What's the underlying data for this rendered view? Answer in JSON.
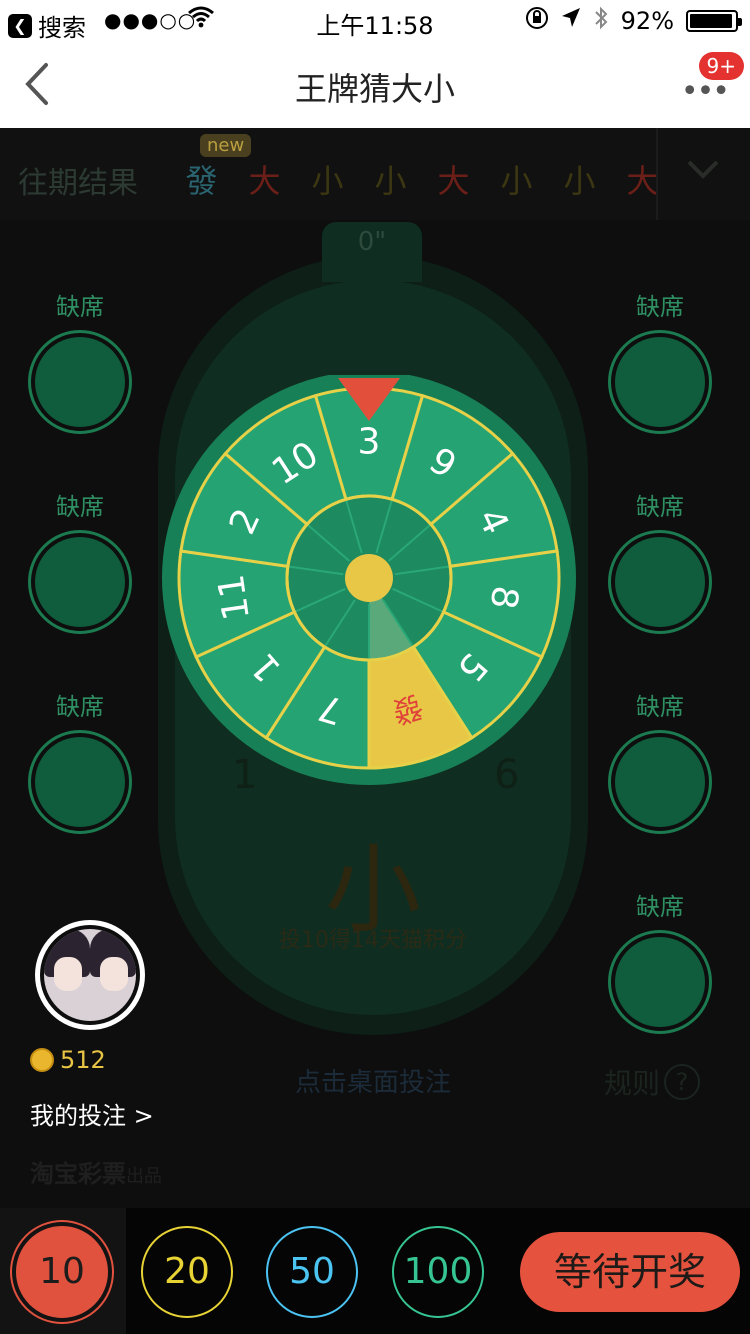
{
  "status_bar": {
    "back_app": "搜索",
    "signal": "●●●○○",
    "time": "上午11:58",
    "battery": "92%"
  },
  "nav": {
    "title": "王牌猜大小",
    "badge": "9+"
  },
  "history": {
    "label": "往期结果",
    "new_tag": "new",
    "items": [
      {
        "text": "發",
        "color": "#2a6470"
      },
      {
        "text": "大",
        "color": "#6b1f18"
      },
      {
        "text": "小",
        "color": "#3c3712"
      },
      {
        "text": "小",
        "color": "#3c3712"
      },
      {
        "text": "大",
        "color": "#6b1f18"
      },
      {
        "text": "小",
        "color": "#3c3712"
      },
      {
        "text": "小",
        "color": "#3c3712"
      },
      {
        "text": "大",
        "color": "#6b1f18"
      }
    ]
  },
  "table": {
    "timer": "0\"",
    "result_label": "小",
    "bonus_text": "投10得14天猫积分",
    "bet_hint": "点击桌面投注",
    "rules_label": "规则",
    "faint_left": "1",
    "faint_right": "6"
  },
  "seats": [
    {
      "label": "缺席"
    },
    {
      "label": "缺席"
    },
    {
      "label": "缺席"
    },
    {
      "label": "缺席"
    },
    {
      "label": "缺席"
    },
    {
      "label": "缺席"
    },
    {
      "label": "缺席"
    }
  ],
  "wheel": {
    "segments": [
      "3",
      "9",
      "4",
      "8",
      "5",
      "發",
      "7",
      "1",
      "11",
      "2",
      "10"
    ],
    "colors": {
      "segment": "#25a373",
      "outer": "#188056",
      "line": "#e6d149",
      "highlight": "#e8c646",
      "highlight_text": "#e0403a",
      "pointer": "#e2503c",
      "hub": "#e8c646"
    }
  },
  "player": {
    "coins": "512",
    "my_bets": "我的投注 >"
  },
  "brand": {
    "name": "淘宝彩票",
    "suffix": "出品"
  },
  "chips": [
    "10",
    "20",
    "50",
    "100"
  ],
  "wait_button": "等待开奖"
}
